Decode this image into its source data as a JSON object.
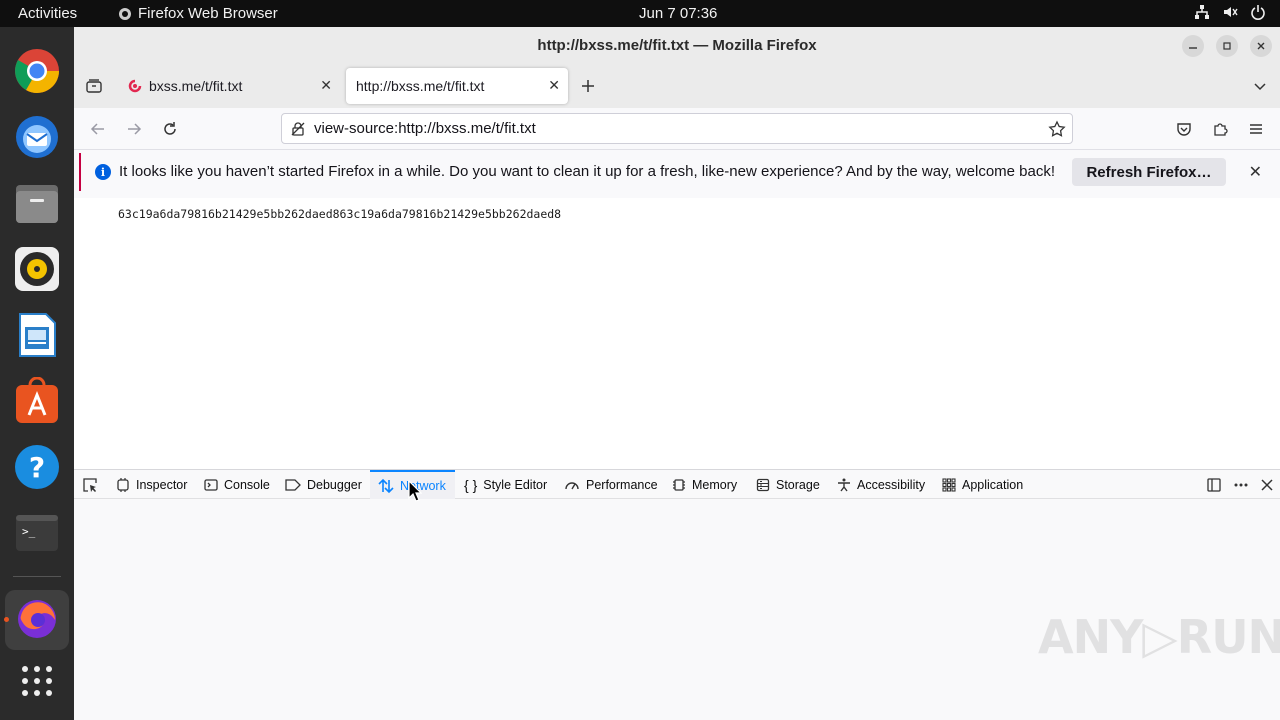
{
  "topbar": {
    "activities": "Activities",
    "app_name": "Firefox Web Browser",
    "clock": "Jun 7  07:36"
  },
  "window": {
    "title": "http://bxss.me/t/fit.txt — Mozilla Firefox"
  },
  "tabs": [
    {
      "label": "bxss.me/t/fit.txt"
    },
    {
      "label": "http://bxss.me/t/fit.txt"
    }
  ],
  "url": "view-source:http://bxss.me/t/fit.txt",
  "notification": {
    "message": "It looks like you haven’t started Firefox in a while. Do you want to clean it up for a fresh, like-new experience? And by the way, welcome back!",
    "button": "Refresh Firefox…"
  },
  "source_text": "63c19a6da79816b21429e5bb262daed863c19a6da79816b21429e5bb262daed8",
  "devtools": {
    "tabs": [
      {
        "label": "Inspector",
        "icon": "inspector-icon"
      },
      {
        "label": "Console",
        "icon": "console-icon"
      },
      {
        "label": "Debugger",
        "icon": "debugger-icon"
      },
      {
        "label": "Network",
        "icon": "network-icon",
        "selected": true
      },
      {
        "label": "Style Editor",
        "icon": "style-editor-icon"
      },
      {
        "label": "Performance",
        "icon": "performance-icon"
      },
      {
        "label": "Memory",
        "icon": "memory-icon"
      },
      {
        "label": "Storage",
        "icon": "storage-icon"
      },
      {
        "label": "Accessibility",
        "icon": "accessibility-icon"
      },
      {
        "label": "Application",
        "icon": "application-icon"
      }
    ]
  },
  "watermark": "ANY▷RUN",
  "colors": {
    "accent": "#0a84ff",
    "notification_border": "#c50042",
    "info_blue": "#0060df",
    "ubuntu_orange": "#e95420"
  }
}
